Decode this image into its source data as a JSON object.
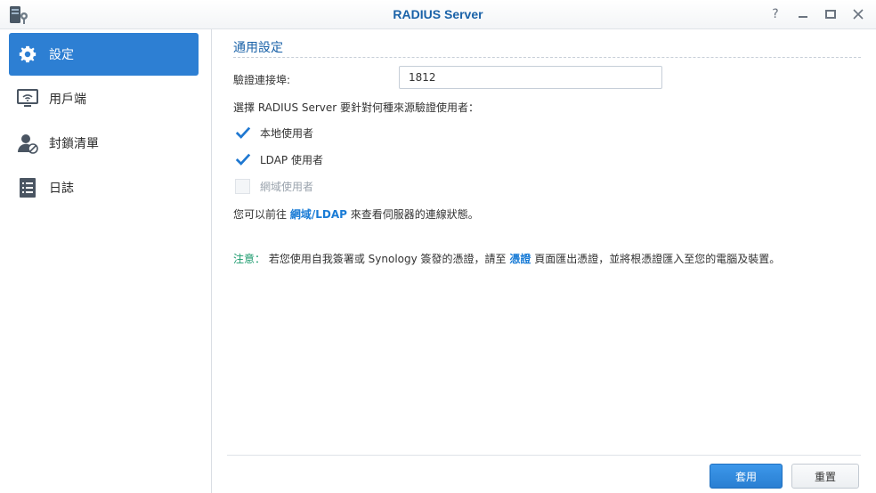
{
  "window": {
    "title": "RADIUS Server",
    "controls": [
      "help-icon",
      "minimize-icon",
      "maximize-icon",
      "close-icon"
    ]
  },
  "sidebar": {
    "items": [
      {
        "label": "設定",
        "icon": "gear-icon",
        "active": true
      },
      {
        "label": "用戶端",
        "icon": "monitor-wifi-icon",
        "active": false
      },
      {
        "label": "封鎖清單",
        "icon": "user-blocked-icon",
        "active": false
      },
      {
        "label": "日誌",
        "icon": "log-list-icon",
        "active": false
      }
    ]
  },
  "main": {
    "section_title": "通用設定",
    "port_label": "驗證連接埠:",
    "port_value": "1812",
    "source_prompt": "選擇 RADIUS Server 要針對何種來源驗證使用者：",
    "sources": [
      {
        "label": "本地使用者",
        "checked": true,
        "disabled": false
      },
      {
        "label": "LDAP 使用者",
        "checked": true,
        "disabled": false
      },
      {
        "label": "網域使用者",
        "checked": false,
        "disabled": true
      }
    ],
    "status_text_before": "您可以前往",
    "status_link": "網域/LDAP",
    "status_text_after": "來查看伺服器的連線狀態。",
    "note_label": "注意：",
    "note_text_before": "若您使用自我簽署或 Synology 簽發的憑證，請至",
    "note_link": "憑證",
    "note_text_after": "頁面匯出憑證，並將根憑證匯入至您的電腦及裝置。"
  },
  "footer": {
    "apply_label": "套用",
    "reset_label": "重置"
  },
  "colors": {
    "accent": "#2d7fd3",
    "title_blue": "#1a62a8",
    "link_blue": "#1a7cd6",
    "note_green": "#1a9a6c"
  }
}
